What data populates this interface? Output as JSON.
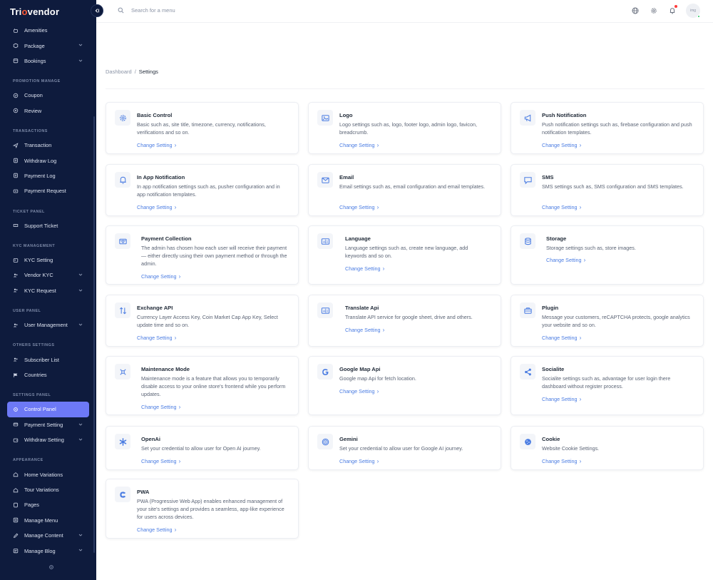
{
  "brand": {
    "logo_text_pre": "Tri",
    "logo_text_o": "o",
    "logo_text_post": "vendor"
  },
  "sidebar": {
    "groups": [
      {
        "label": "",
        "items": [
          {
            "label": "Amenities",
            "icon": "amenities-icon",
            "chevron": false
          },
          {
            "label": "Package",
            "icon": "package-icon",
            "chevron": true
          },
          {
            "label": "Bookings",
            "icon": "bookings-icon",
            "chevron": true
          }
        ]
      },
      {
        "label": "PROMOTION MANAGE",
        "items": [
          {
            "label": "Coupon",
            "icon": "coupon-icon",
            "chevron": false
          },
          {
            "label": "Review",
            "icon": "review-icon",
            "chevron": false
          }
        ]
      },
      {
        "label": "TRANSACTIONS",
        "items": [
          {
            "label": "Transaction",
            "icon": "send-icon",
            "chevron": false
          },
          {
            "label": "Withdraw Log",
            "icon": "log-icon",
            "chevron": false
          },
          {
            "label": "Payment Log",
            "icon": "log-icon",
            "chevron": false
          },
          {
            "label": "Payment Request",
            "icon": "request-icon",
            "chevron": false
          }
        ]
      },
      {
        "label": "TICKET PANEL",
        "items": [
          {
            "label": "Support Ticket",
            "icon": "support-icon",
            "chevron": false
          }
        ]
      },
      {
        "label": "KYC MANAGEMENT",
        "items": [
          {
            "label": "KYC Setting",
            "icon": "kyc-icon",
            "chevron": false
          },
          {
            "label": "Vendor KYC",
            "icon": "users-icon",
            "chevron": true
          },
          {
            "label": "KYC Request",
            "icon": "users-icon",
            "chevron": true
          }
        ]
      },
      {
        "label": "USER PANEL",
        "items": [
          {
            "label": "User Management",
            "icon": "users-icon",
            "chevron": true
          }
        ]
      },
      {
        "label": "OTHERS SETTINGS",
        "items": [
          {
            "label": "Subscriber List",
            "icon": "users-icon",
            "chevron": false
          },
          {
            "label": "Countries",
            "icon": "flag-icon",
            "chevron": false
          }
        ]
      },
      {
        "label": "SETTINGS PANEL",
        "items": [
          {
            "label": "Control Panel",
            "icon": "control-icon",
            "chevron": false,
            "active": true
          },
          {
            "label": "Payment Setting",
            "icon": "payment-icon",
            "chevron": true
          },
          {
            "label": "Withdraw Setting",
            "icon": "withdraw-icon",
            "chevron": true
          }
        ]
      },
      {
        "label": "APPEARANCE",
        "items": [
          {
            "label": "Home Variations",
            "icon": "home-icon",
            "chevron": false
          },
          {
            "label": "Tour Variations",
            "icon": "tour-icon",
            "chevron": false
          },
          {
            "label": "Pages",
            "icon": "pages-icon",
            "chevron": false
          },
          {
            "label": "Manage Menu",
            "icon": "menu-icon",
            "chevron": false
          },
          {
            "label": "Manage Content",
            "icon": "content-icon",
            "chevron": true
          },
          {
            "label": "Manage Blog",
            "icon": "blog-icon",
            "chevron": true
          }
        ]
      }
    ]
  },
  "header": {
    "search_placeholder": "Search for a menu",
    "avatar_text": "img"
  },
  "breadcrumb": {
    "parent": "Dashboard",
    "separator": "/",
    "current": "Settings"
  },
  "link_label": "Change Setting",
  "link_arrow": "›",
  "accent": "#4a7ce2",
  "cards": [
    {
      "title": "Basic Control",
      "icon": "gear-icon",
      "desc": "Basic such as, site title, timezone, currency, notifications, verifications and so on."
    },
    {
      "title": "Logo",
      "icon": "image-icon",
      "desc": "Logo settings such as, logo, footer logo, admin logo, favicon, breadcrumb."
    },
    {
      "title": "Push Notification",
      "icon": "megaphone-icon",
      "desc": "Push notification settings such as, firebase configuration and push notification templates."
    },
    {
      "title": "In App Notification",
      "icon": "bell-icon",
      "desc": "In app notification settings such as, pusher configuration and in app notification templates."
    },
    {
      "title": "Email",
      "icon": "mail-icon",
      "desc": "Email settings such as, email configuration and email templates."
    },
    {
      "title": "SMS",
      "icon": "chat-icon",
      "desc": "SMS settings such as, SMS configuration and SMS templates."
    },
    {
      "title": "Payment Collection",
      "icon": "cash-icon",
      "desc": "The admin has chosen how each user will receive their payment — either directly using their own payment method or through the admin."
    },
    {
      "title": "Language",
      "icon": "translate-icon",
      "desc": "Language settings such as, create new language, add keywords and so on."
    },
    {
      "title": "Storage",
      "icon": "database-icon",
      "desc": "Storage settings such as, store images."
    },
    {
      "title": "Exchange API",
      "icon": "exchange-icon",
      "desc": "Currency Layer Access Key, Coin Market Cap App Key, Select update time and so on."
    },
    {
      "title": "Translate Api",
      "icon": "translate-icon",
      "desc": "Translate API service for google sheet, drive and others."
    },
    {
      "title": "Plugin",
      "icon": "toolbox-icon",
      "desc": "Message your customers, reCAPTCHA protects, google analytics your website and so on."
    },
    {
      "title": "Maintenance Mode",
      "icon": "maintenance-icon",
      "desc": "Maintenance mode is a feature that allows you to temporarily disable access to your online store's frontend while you perform updates."
    },
    {
      "title": "Google Map Api",
      "icon": "google-icon",
      "desc": "Google map Api for fetch location."
    },
    {
      "title": "Socialite",
      "icon": "share-icon",
      "desc": "Socialite settings such as, advantage for user login there dashboard without register process."
    },
    {
      "title": "OpenAi",
      "icon": "openai-icon",
      "desc": "Set your credential to allow user for Open AI journey."
    },
    {
      "title": "Gemini",
      "icon": "gemini-icon",
      "desc": "Set your credential to allow user for Google AI journey."
    },
    {
      "title": "Cookie",
      "icon": "cookie-icon",
      "desc": "Website Cookie Settings."
    },
    {
      "title": "PWA",
      "icon": "pwa-icon",
      "desc": "PWA (Progressive Web App) enables enhanced management of your site's settings and provides a seamless, app-like experience for users across devices."
    }
  ]
}
